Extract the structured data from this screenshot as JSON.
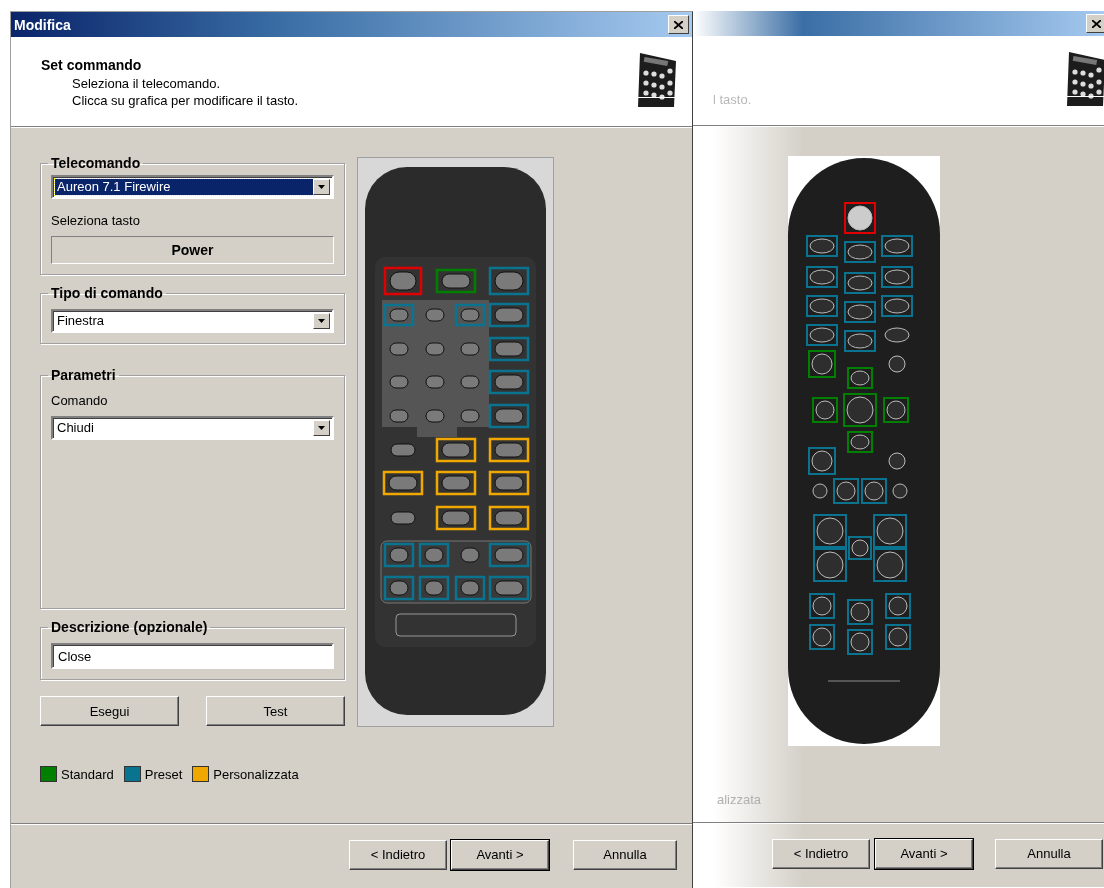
{
  "main_dialog": {
    "title": "Modifica",
    "header": {
      "title": "Set commando",
      "lines": [
        "Seleziona il telecomando.",
        "Clicca su grafica per modificare il tasto."
      ]
    },
    "remote_group": {
      "label": "Telecomando",
      "value": "Aureon 7.1 Firewire",
      "highlighted": true,
      "key_label": "Seleziona tasto",
      "key": "Power"
    },
    "command_type_group": {
      "label": "Tipo di comando",
      "value": "Finestra",
      "highlighted": false
    },
    "parameters_group": {
      "label": "Parametri",
      "field_label": "Comando",
      "value": "Chiudi",
      "highlighted": false
    },
    "description_group": {
      "label": "Descrizione (opzionale)",
      "value": "Close"
    },
    "action_buttons": [
      "Esegui",
      "Test"
    ],
    "legend": [
      {
        "label": "Standard",
        "color": "#008000"
      },
      {
        "label": "Preset",
        "color": "#0a7490"
      },
      {
        "label": "Personalizzata",
        "color": "#f0a800"
      }
    ],
    "nav_buttons": [
      {
        "label": "< Indietro",
        "default": false
      },
      {
        "label": "Avanti >",
        "default": true
      },
      {
        "label": "Annulla",
        "default": false
      }
    ]
  },
  "second_dialog": {
    "header_text": "l tasto.",
    "legend_text": "alizzata",
    "nav_buttons": [
      {
        "label": "< Indietro",
        "default": false
      },
      {
        "label": "Avanti >",
        "default": true
      },
      {
        "label": "Annulla",
        "default": false
      }
    ]
  }
}
